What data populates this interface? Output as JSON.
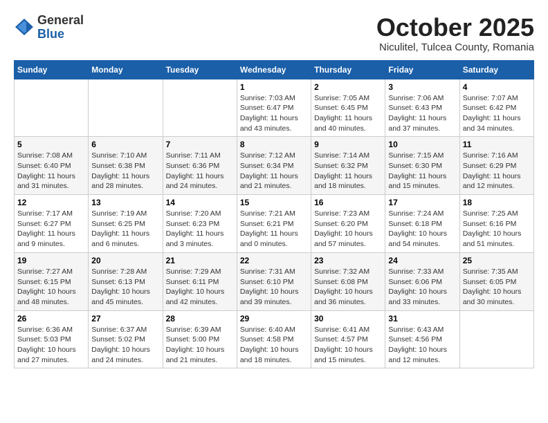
{
  "header": {
    "logo_general": "General",
    "logo_blue": "Blue",
    "month_title": "October 2025",
    "subtitle": "Niculitel, Tulcea County, Romania"
  },
  "weekdays": [
    "Sunday",
    "Monday",
    "Tuesday",
    "Wednesday",
    "Thursday",
    "Friday",
    "Saturday"
  ],
  "weeks": [
    [
      {
        "day": "",
        "info": ""
      },
      {
        "day": "",
        "info": ""
      },
      {
        "day": "",
        "info": ""
      },
      {
        "day": "1",
        "info": "Sunrise: 7:03 AM\nSunset: 6:47 PM\nDaylight: 11 hours and 43 minutes."
      },
      {
        "day": "2",
        "info": "Sunrise: 7:05 AM\nSunset: 6:45 PM\nDaylight: 11 hours and 40 minutes."
      },
      {
        "day": "3",
        "info": "Sunrise: 7:06 AM\nSunset: 6:43 PM\nDaylight: 11 hours and 37 minutes."
      },
      {
        "day": "4",
        "info": "Sunrise: 7:07 AM\nSunset: 6:42 PM\nDaylight: 11 hours and 34 minutes."
      }
    ],
    [
      {
        "day": "5",
        "info": "Sunrise: 7:08 AM\nSunset: 6:40 PM\nDaylight: 11 hours and 31 minutes."
      },
      {
        "day": "6",
        "info": "Sunrise: 7:10 AM\nSunset: 6:38 PM\nDaylight: 11 hours and 28 minutes."
      },
      {
        "day": "7",
        "info": "Sunrise: 7:11 AM\nSunset: 6:36 PM\nDaylight: 11 hours and 24 minutes."
      },
      {
        "day": "8",
        "info": "Sunrise: 7:12 AM\nSunset: 6:34 PM\nDaylight: 11 hours and 21 minutes."
      },
      {
        "day": "9",
        "info": "Sunrise: 7:14 AM\nSunset: 6:32 PM\nDaylight: 11 hours and 18 minutes."
      },
      {
        "day": "10",
        "info": "Sunrise: 7:15 AM\nSunset: 6:30 PM\nDaylight: 11 hours and 15 minutes."
      },
      {
        "day": "11",
        "info": "Sunrise: 7:16 AM\nSunset: 6:29 PM\nDaylight: 11 hours and 12 minutes."
      }
    ],
    [
      {
        "day": "12",
        "info": "Sunrise: 7:17 AM\nSunset: 6:27 PM\nDaylight: 11 hours and 9 minutes."
      },
      {
        "day": "13",
        "info": "Sunrise: 7:19 AM\nSunset: 6:25 PM\nDaylight: 11 hours and 6 minutes."
      },
      {
        "day": "14",
        "info": "Sunrise: 7:20 AM\nSunset: 6:23 PM\nDaylight: 11 hours and 3 minutes."
      },
      {
        "day": "15",
        "info": "Sunrise: 7:21 AM\nSunset: 6:21 PM\nDaylight: 11 hours and 0 minutes."
      },
      {
        "day": "16",
        "info": "Sunrise: 7:23 AM\nSunset: 6:20 PM\nDaylight: 10 hours and 57 minutes."
      },
      {
        "day": "17",
        "info": "Sunrise: 7:24 AM\nSunset: 6:18 PM\nDaylight: 10 hours and 54 minutes."
      },
      {
        "day": "18",
        "info": "Sunrise: 7:25 AM\nSunset: 6:16 PM\nDaylight: 10 hours and 51 minutes."
      }
    ],
    [
      {
        "day": "19",
        "info": "Sunrise: 7:27 AM\nSunset: 6:15 PM\nDaylight: 10 hours and 48 minutes."
      },
      {
        "day": "20",
        "info": "Sunrise: 7:28 AM\nSunset: 6:13 PM\nDaylight: 10 hours and 45 minutes."
      },
      {
        "day": "21",
        "info": "Sunrise: 7:29 AM\nSunset: 6:11 PM\nDaylight: 10 hours and 42 minutes."
      },
      {
        "day": "22",
        "info": "Sunrise: 7:31 AM\nSunset: 6:10 PM\nDaylight: 10 hours and 39 minutes."
      },
      {
        "day": "23",
        "info": "Sunrise: 7:32 AM\nSunset: 6:08 PM\nDaylight: 10 hours and 36 minutes."
      },
      {
        "day": "24",
        "info": "Sunrise: 7:33 AM\nSunset: 6:06 PM\nDaylight: 10 hours and 33 minutes."
      },
      {
        "day": "25",
        "info": "Sunrise: 7:35 AM\nSunset: 6:05 PM\nDaylight: 10 hours and 30 minutes."
      }
    ],
    [
      {
        "day": "26",
        "info": "Sunrise: 6:36 AM\nSunset: 5:03 PM\nDaylight: 10 hours and 27 minutes."
      },
      {
        "day": "27",
        "info": "Sunrise: 6:37 AM\nSunset: 5:02 PM\nDaylight: 10 hours and 24 minutes."
      },
      {
        "day": "28",
        "info": "Sunrise: 6:39 AM\nSunset: 5:00 PM\nDaylight: 10 hours and 21 minutes."
      },
      {
        "day": "29",
        "info": "Sunrise: 6:40 AM\nSunset: 4:58 PM\nDaylight: 10 hours and 18 minutes."
      },
      {
        "day": "30",
        "info": "Sunrise: 6:41 AM\nSunset: 4:57 PM\nDaylight: 10 hours and 15 minutes."
      },
      {
        "day": "31",
        "info": "Sunrise: 6:43 AM\nSunset: 4:56 PM\nDaylight: 10 hours and 12 minutes."
      },
      {
        "day": "",
        "info": ""
      }
    ]
  ]
}
